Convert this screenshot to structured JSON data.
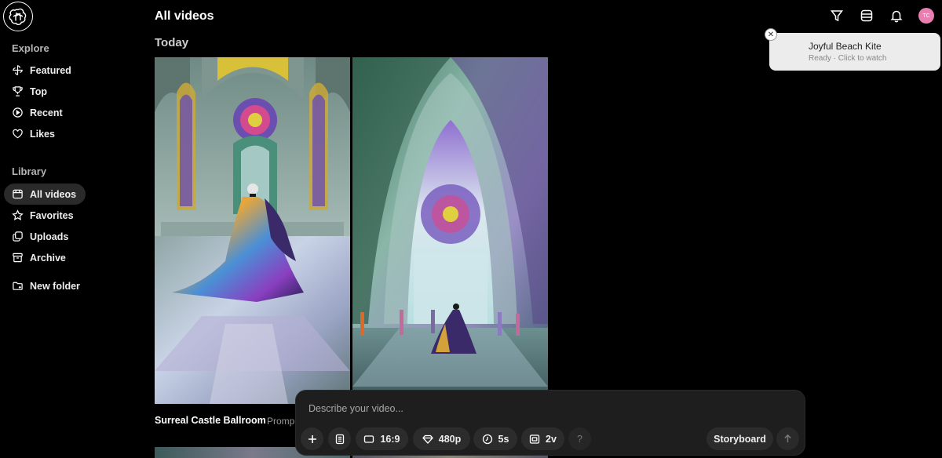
{
  "sidebar": {
    "explore_title": "Explore",
    "explore_items": [
      {
        "label": "Featured",
        "icon": "pinwheel-icon"
      },
      {
        "label": "Top",
        "icon": "trophy-icon"
      },
      {
        "label": "Recent",
        "icon": "play-circle-icon"
      },
      {
        "label": "Likes",
        "icon": "heart-icon"
      }
    ],
    "library_title": "Library",
    "library_items": [
      {
        "label": "All videos",
        "icon": "video-library-icon",
        "active": true
      },
      {
        "label": "Favorites",
        "icon": "star-icon"
      },
      {
        "label": "Uploads",
        "icon": "uploads-icon"
      },
      {
        "label": "Archive",
        "icon": "archive-icon"
      }
    ],
    "new_folder": "New folder"
  },
  "header": {
    "title": "All videos",
    "group": "Today",
    "avatar_initials": "TC"
  },
  "toast": {
    "title": "Joyful Beach Kite",
    "subtitle": "Ready · Click to watch"
  },
  "video": {
    "title": "Surreal Castle Ballroom",
    "prompt_preview": "Promp"
  },
  "composer": {
    "placeholder": "Describe your video...",
    "aspect": "16:9",
    "resolution": "480p",
    "duration": "5s",
    "variations": "2v",
    "help": "?",
    "storyboard": "Storyboard"
  }
}
